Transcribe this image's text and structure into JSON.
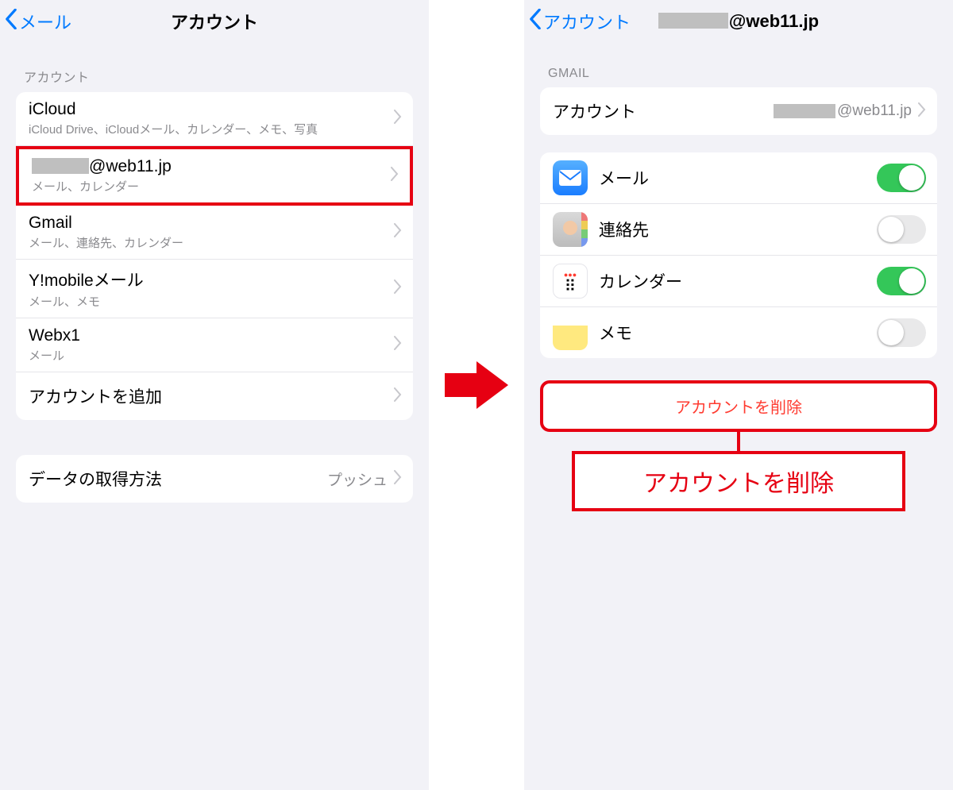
{
  "left": {
    "nav": {
      "back": "メール",
      "title": "アカウント"
    },
    "section_label": "アカウント",
    "accounts": [
      {
        "title": "iCloud",
        "sub": "iCloud Drive、iCloudメール、カレンダー、メモ、写真",
        "highlight": false
      },
      {
        "title": "@web11.jp",
        "sub": "メール、カレンダー",
        "highlight": true,
        "redact_prefix": true
      },
      {
        "title": "Gmail",
        "sub": "メール、連絡先、カレンダー",
        "highlight": false
      },
      {
        "title": "Y!mobileメール",
        "sub": "メール、メモ",
        "highlight": false
      },
      {
        "title": "Webx1",
        "sub": "メール",
        "highlight": false
      }
    ],
    "add_account": "アカウントを追加",
    "fetch": {
      "label": "データの取得方法",
      "value": "プッシュ"
    }
  },
  "right": {
    "nav": {
      "back": "アカウント",
      "title": "@web11.jp"
    },
    "section_label": "GMAIL",
    "account_row": {
      "label": "アカウント",
      "value": "@web11.jp"
    },
    "services": [
      {
        "label": "メール",
        "on": true,
        "icon": "mail"
      },
      {
        "label": "連絡先",
        "on": false,
        "icon": "contacts"
      },
      {
        "label": "カレンダー",
        "on": true,
        "icon": "calendar"
      },
      {
        "label": "メモ",
        "on": false,
        "icon": "notes"
      }
    ],
    "delete_label": "アカウントを削除",
    "callout": "アカウントを削除"
  }
}
